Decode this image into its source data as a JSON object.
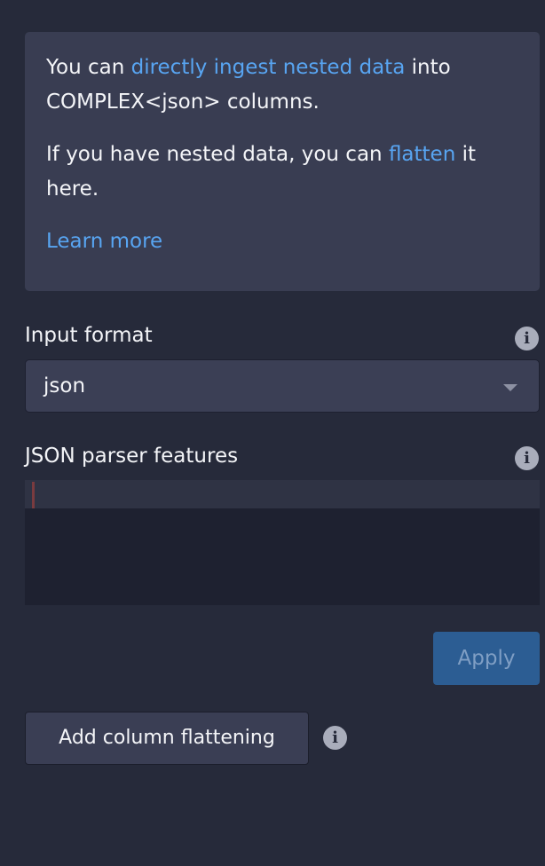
{
  "callout": {
    "p1_before": "You can ",
    "p1_link": "directly ingest nested data",
    "p1_after": " into COMPLEX<json> columns.",
    "p2_before": "If you have nested data, you can ",
    "p2_link": "flatten",
    "p2_after": " it here.",
    "learn_more": "Learn more"
  },
  "input_format": {
    "label": "Input format",
    "value": "json"
  },
  "json_parser": {
    "label": "JSON parser features",
    "content": ""
  },
  "buttons": {
    "apply": "Apply",
    "add_column_flattening": "Add column flattening"
  },
  "colors": {
    "background": "#262a3a",
    "callout_bg": "#393d52",
    "link": "#58a5f2",
    "primary_button": "#2c5d93"
  },
  "icons": {
    "info": "info-circle-icon",
    "dropdown": "caret-down-icon"
  }
}
